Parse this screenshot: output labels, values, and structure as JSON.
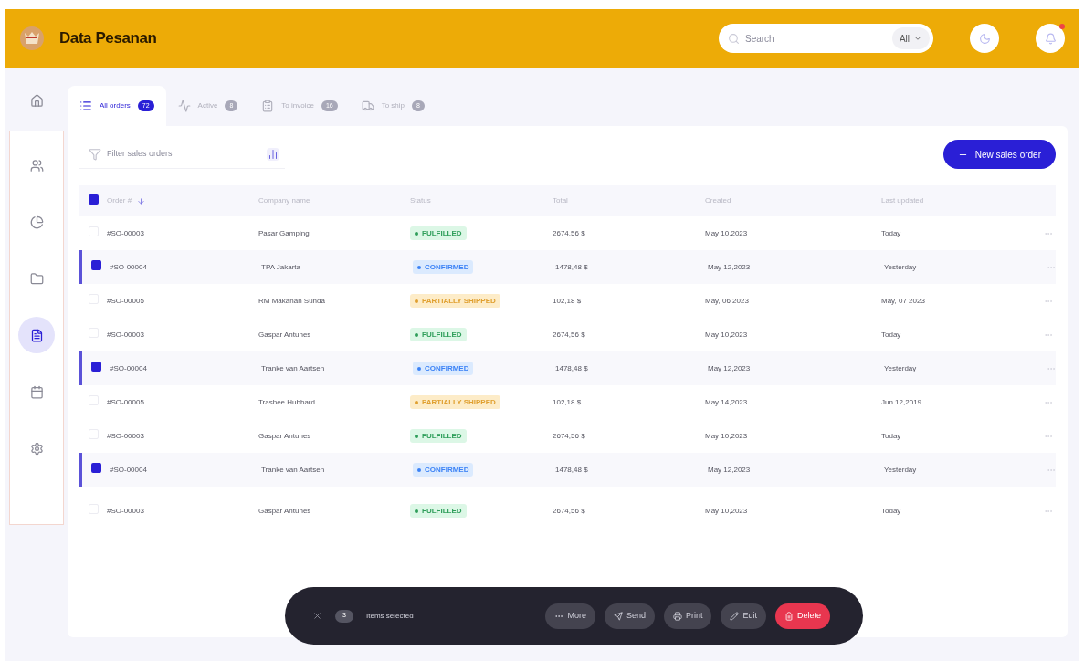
{
  "header": {
    "title": "Data Pesanan",
    "search": {
      "placeholder": "Search",
      "scope": "All"
    },
    "actions": [
      {
        "alert": false
      },
      {
        "alert": true
      }
    ]
  },
  "sidebar": {
    "items": [
      {
        "selected": false
      },
      {
        "selected": false
      },
      {
        "selected": false
      },
      {
        "selected": false
      },
      {
        "selected": true
      },
      {
        "selected": false
      },
      {
        "selected": false
      }
    ]
  },
  "tabs": [
    {
      "label": "All orders",
      "count": "72",
      "selected": true
    },
    {
      "label": "Active",
      "count": "8",
      "selected": false
    },
    {
      "label": "To invoice",
      "count": "16",
      "selected": false
    },
    {
      "label": "To ship",
      "count": "8",
      "selected": false
    }
  ],
  "toolbar": {
    "filter_placeholder": "Filter sales orders",
    "new_button": "New sales order"
  },
  "table": {
    "all_checked": true,
    "columns": [
      "Order #",
      "Company name",
      "Status",
      "Total",
      "Created",
      "Last updated"
    ],
    "rows": [
      {
        "selected": false,
        "order": "#SO-00003",
        "company": "Pasar Gamping",
        "status": {
          "kind": "fulfilled",
          "label": "FULFILLED"
        },
        "total": "2674,56 $",
        "created": "May 10,2023",
        "updated": "Today"
      },
      {
        "selected": true,
        "order": "#SO-00004",
        "company": "TPA Jakarta",
        "status": {
          "kind": "confirmed",
          "label": "CONFIRMED"
        },
        "total": "1478,48 $",
        "created": "May 12,2023",
        "updated": "Yesterday"
      },
      {
        "selected": false,
        "order": "#SO-00005",
        "company": "RM Makanan Sunda",
        "status": {
          "kind": "partial",
          "label": "PARTIALLY SHIPPED"
        },
        "total": "102,18 $",
        "created": "May, 06 2023",
        "updated": "May, 07 2023"
      },
      {
        "selected": false,
        "order": "#SO-00003",
        "company": "Gaspar Antunes",
        "status": {
          "kind": "fulfilled",
          "label": "FULFILLED"
        },
        "total": "2674,56 $",
        "created": "May 10,2023",
        "updated": "Today"
      },
      {
        "selected": true,
        "order": "#SO-00004",
        "company": "Tranke van Aartsen",
        "status": {
          "kind": "confirmed",
          "label": "CONFIRMED"
        },
        "total": "1478,48 $",
        "created": "May 12,2023",
        "updated": "Yesterday"
      },
      {
        "selected": false,
        "order": "#SO-00005",
        "company": "Trashee Hubbard",
        "status": {
          "kind": "partial",
          "label": "PARTIALLY SHIPPED"
        },
        "total": "102,18 $",
        "created": "May 14,2023",
        "updated": "Jun 12,2019"
      },
      {
        "selected": false,
        "order": "#SO-00003",
        "company": "Gaspar Antunes",
        "status": {
          "kind": "fulfilled",
          "label": "FULFILLED"
        },
        "total": "2674,56 $",
        "created": "May 10,2023",
        "updated": "Today"
      },
      {
        "selected": true,
        "order": "#SO-00004",
        "company": "Tranke van Aartsen",
        "status": {
          "kind": "confirmed",
          "label": "CONFIRMED"
        },
        "total": "1478,48 $",
        "created": "May 12,2023",
        "updated": "Yesterday"
      },
      {
        "selected": false,
        "order": "#SO-00003",
        "company": "Gaspar Antunes",
        "status": {
          "kind": "fulfilled",
          "label": "FULFILLED"
        },
        "total": "2674,56 $",
        "created": "May 10,2023",
        "updated": "Today"
      }
    ]
  },
  "action_bar": {
    "count": "3",
    "label": "Items selected",
    "buttons": [
      {
        "kind": "more",
        "label": "More"
      },
      {
        "kind": "send",
        "label": "Send"
      },
      {
        "kind": "print",
        "label": "Print"
      },
      {
        "kind": "edit",
        "label": "Edit"
      },
      {
        "kind": "delete",
        "label": "Delete"
      }
    ]
  }
}
